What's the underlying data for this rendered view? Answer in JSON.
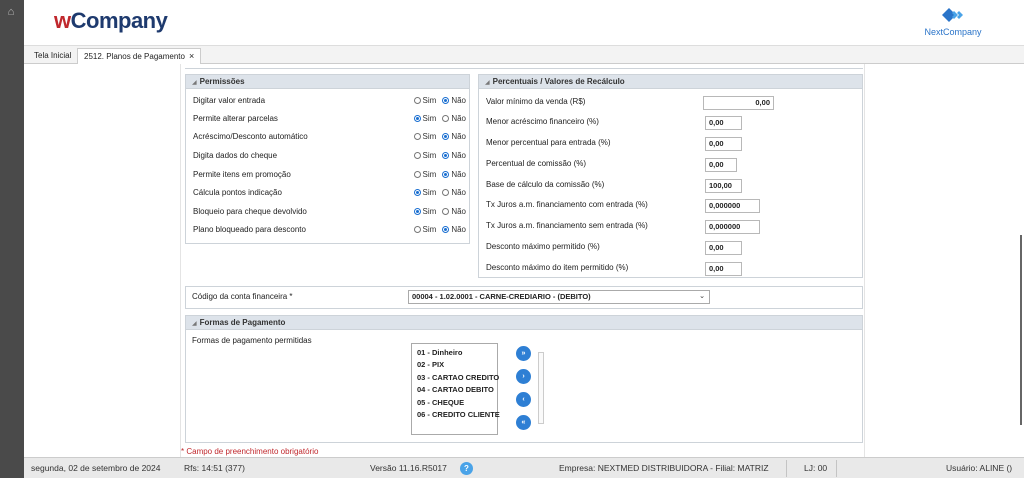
{
  "brand": {
    "logo_w": "w",
    "logo_rest": "Company",
    "right_logo_label": "NextCompany",
    "accent": "#1e3a6e",
    "red": "#c0282d",
    "blue": "#2a74c9"
  },
  "tabs": [
    {
      "label": "Tela Inicial"
    },
    {
      "label": "2512. Planos de Pagamento",
      "close": "×"
    }
  ],
  "permissoes": {
    "title": "Permissões",
    "option_yes": "Sim",
    "option_no": "Não",
    "rows": [
      {
        "label": "Digitar valor entrada",
        "selected": "Não"
      },
      {
        "label": "Permite alterar parcelas",
        "selected": "Sim"
      },
      {
        "label": "Acréscimo/Desconto automático",
        "selected": "Não"
      },
      {
        "label": "Digita dados do cheque",
        "selected": "Não"
      },
      {
        "label": "Permite itens em promoção",
        "selected": "Não"
      },
      {
        "label": "Cálcula pontos indicação",
        "selected": "Sim"
      },
      {
        "label": "Bloqueio para cheque devolvido",
        "selected": "Sim"
      },
      {
        "label": "Plano bloqueado para desconto",
        "selected": "Não"
      }
    ]
  },
  "percentuais": {
    "title": "Percentuais / Valores de Recálculo",
    "rows": [
      {
        "label": "Valor mínimo da venda (R$)",
        "value": "0,00"
      },
      {
        "label": "Menor acréscimo financeiro (%)",
        "value": "0,00"
      },
      {
        "label": "Menor percentual para entrada (%)",
        "value": "0,00"
      },
      {
        "label": "Percentual de comissão (%)",
        "value": "0,00"
      },
      {
        "label": "Base de cálculo da comissão (%)",
        "value": "100,00"
      },
      {
        "label": "Tx Juros a.m. financiamento com entrada (%)",
        "value": "0,000000"
      },
      {
        "label": "Tx Juros a.m. financiamento sem entrada (%)",
        "value": "0,000000"
      },
      {
        "label": "Desconto máximo permitido (%)",
        "value": "0,00"
      },
      {
        "label": "Desconto máximo do item permitido (%)",
        "value": "0,00"
      }
    ]
  },
  "conta": {
    "label": "Código da conta financeira *",
    "value": "00004 - 1.02.0001 - CARNE-CREDIARIO - (DEBITO)"
  },
  "formas": {
    "title": "Formas de Pagamento",
    "label": "Formas de pagamento permitidas",
    "items": [
      "01 - Dinheiro",
      "02 - PIX",
      "03 - CARTAO CREDITO",
      "04 - CARTAO DEBITO",
      "05 - CHEQUE",
      "06 - CREDITO CLIENTE"
    ],
    "buttons": [
      "move-all-right",
      "move-right",
      "move-left",
      "move-all-left"
    ]
  },
  "required_note": "* Campo de preenchimento obrigatório",
  "status": {
    "date": "segunda, 02 de setembro de 2024",
    "rfs": "Rfs: 14:51 (377)",
    "version": "Versão 11.16.R5017",
    "help": "?",
    "empresa": "Empresa: NEXTMED DISTRIBUIDORA - Filial: MATRIZ",
    "lj": "LJ: 00",
    "usuario": "Usuário: ALINE ()"
  }
}
